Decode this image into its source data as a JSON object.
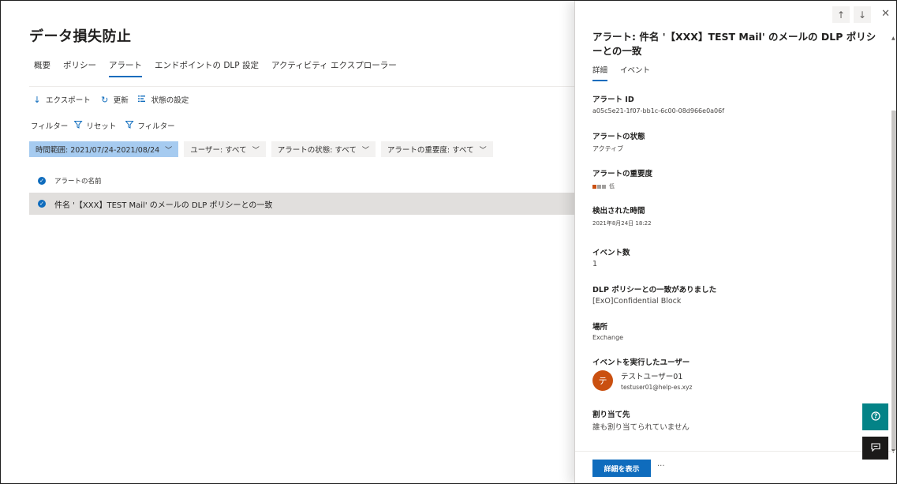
{
  "page": {
    "title": "データ損失防止",
    "tabs": [
      "概要",
      "ポリシー",
      "アラート",
      "エンドポイントの DLP 設定",
      "アクティビティ エクスプローラー"
    ],
    "active_tab": 2
  },
  "toolbar": {
    "export_label": "エクスポート",
    "refresh_label": "更新",
    "status_settings_label": "状態の設定"
  },
  "filters": {
    "label": "フィルター",
    "reset_label": "リセット",
    "filter_label": "フィルター",
    "pills": [
      {
        "label": "時間範囲: 2021/07/24-2021/08/24",
        "active": true
      },
      {
        "label": "ユーザー: すべて",
        "active": false
      },
      {
        "label": "アラートの状態: すべて",
        "active": false
      },
      {
        "label": "アラートの重要度: すべて",
        "active": false
      }
    ]
  },
  "list": {
    "column_header": "アラートの名前",
    "rows": [
      {
        "name": "件名 '【XXX】TEST Mail' のメールの DLP ポリシーとの一致"
      }
    ]
  },
  "panel": {
    "title": "アラート: 件名 '【XXX】TEST Mail' のメールの DLP ポリシーとの一致",
    "tabs": [
      "詳細",
      "イベント"
    ],
    "fields": {
      "alert_id_label": "アラート ID",
      "alert_id": "a05c5e21-1f07-bb1c-6c00-08d966e0a06f",
      "status_label": "アラートの状態",
      "status": "アクティブ",
      "severity_label": "アラートの重要度",
      "severity": "低",
      "severity_level": 1,
      "severity_max": 3,
      "detected_label": "検出された時間",
      "detected": "2021年8月24日 18:22",
      "event_count_label": "イベント数",
      "event_count": "1",
      "policy_match_label": "DLP ポリシーとの一致がありました",
      "policy_match": "[ExO]Confidential Block",
      "location_label": "場所",
      "location": "Exchange",
      "user_label": "イベントを実行したユーザー",
      "user_initial": "テ",
      "user_name": "テストユーザー01",
      "user_email": "testuser01@help-es.xyz",
      "assigned_label": "割り当て先",
      "assigned": "誰も割り当てられていません"
    },
    "view_details_label": "詳細を表示",
    "more_label": "···"
  },
  "colors": {
    "accent": "#0f6cbd",
    "severity_active": "#ca5010",
    "severity_inactive": "#a19f9d",
    "avatar": "#ca5010",
    "help": "#038387"
  },
  "icons": {
    "export": "download-icon",
    "refresh": "refresh-icon",
    "status": "list-settings-icon",
    "filter": "funnel-icon",
    "up": "arrow-up-icon",
    "down": "arrow-down-icon",
    "close": "close-icon",
    "help": "help-icon",
    "feedback": "feedback-icon"
  }
}
